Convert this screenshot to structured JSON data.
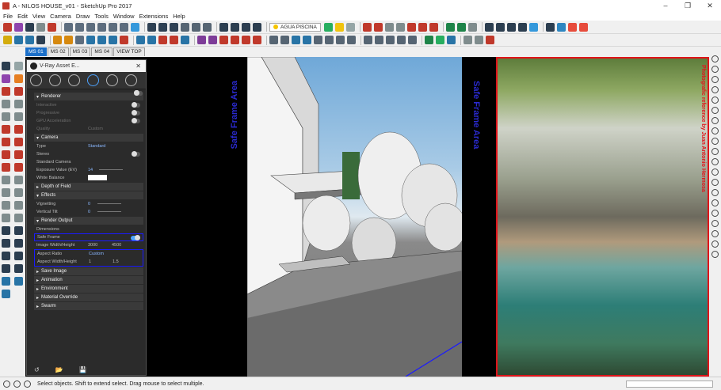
{
  "window": {
    "title": "A - NILOS HOUSE_v01 - SketchUp Pro 2017",
    "controls": [
      "–",
      "❐",
      "✕"
    ]
  },
  "menu": [
    "File",
    "Edit",
    "View",
    "Camera",
    "Draw",
    "Tools",
    "Window",
    "Extensions",
    "Help"
  ],
  "layer": "AGUA PISCINA",
  "scenes": [
    "MS 01",
    "MS 02",
    "MS 03",
    "MS 04",
    "VIEW TOP"
  ],
  "active_scene": "MS 01",
  "viewport": {
    "safe_frame_left": "Safe Frame Area",
    "safe_frame_right": "Safe Frame Area",
    "photo_caption": "Photografic reference by Juan Antonio Hermosa"
  },
  "vray": {
    "title": "V-Ray Asset E...",
    "close": "✕",
    "renderer": {
      "header": "Renderer",
      "interactive": "Interactive",
      "progressive": "Progressive",
      "gpu": "GPU Acceleration",
      "quality": "Quality",
      "quality_value": "Custom"
    },
    "camera": {
      "header": "Camera",
      "type_label": "Type",
      "type_value": "Standard",
      "stereo": "Stereo",
      "standard_camera": "Standard Camera",
      "exposure_label": "Exposure Value (EV)",
      "exposure_value": "14",
      "white_balance": "White Balance",
      "depth_of_field": "Depth of Field",
      "effects": "Effects",
      "vignetting": "Vignetting",
      "vignetting_value": "0",
      "vertical_tilt": "Vertical Tilt",
      "vertical_tilt_value": "0"
    },
    "render_output": {
      "header": "Render Output",
      "dimensions": "Dimensions",
      "safe_frame": "Safe Frame",
      "image_wh_label": "Image Width/Height",
      "image_w": "3000",
      "image_h": "4500",
      "aspect_ratio_label": "Aspect Ratio",
      "aspect_ratio_value": "Custom",
      "aspect_wh_label": "Aspect Width/Height",
      "aspect_w": "1",
      "aspect_h": "1.5"
    },
    "sections": [
      "Save Image",
      "Animation",
      "Environment",
      "Material Override",
      "Swarm"
    ]
  },
  "status": {
    "message": "Select objects. Shift to extend select. Drag mouse to select multiple."
  },
  "colors": {
    "safe_frame_label": "#2a2ad0",
    "highlight_box": "#1a1aff",
    "photo_frame": "#e0141a",
    "active_scene": "#1b6fc9"
  }
}
